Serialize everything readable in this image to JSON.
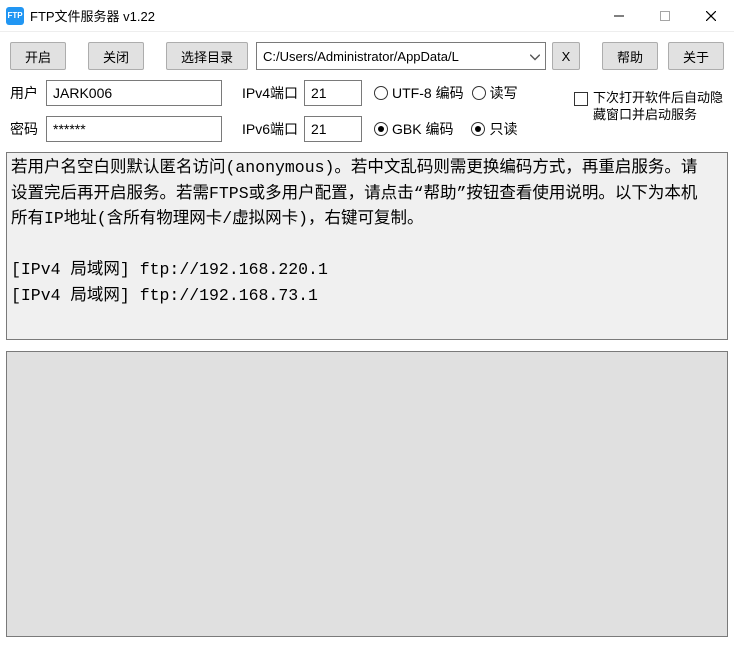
{
  "window": {
    "title": "FTP文件服务器 v1.22",
    "icon_text": "FTP"
  },
  "toolbar": {
    "start": "开启",
    "stop": "关闭",
    "select_dir": "选择目录",
    "path": "C:/Users/Administrator/AppData/L",
    "clear": "X",
    "help": "帮助",
    "about": "关于"
  },
  "config": {
    "user_label": "用户",
    "user_value": "JARK006",
    "pass_label": "密码",
    "pass_value": "******",
    "ipv4_port_label": "IPv4端口",
    "ipv4_port_value": "21",
    "ipv6_port_label": "IPv6端口",
    "ipv6_port_value": "21",
    "encoding_utf8": "UTF-8 编码",
    "encoding_gbk": "GBK 编码",
    "rw_label": "读写",
    "ro_label": "只读",
    "encoding_selected": "gbk",
    "access_selected": "readonly",
    "autostart_label": "下次打开软件后自动隐藏窗口并启动服务",
    "autostart_checked": false
  },
  "info_text": "若用户名空白则默认匿名访问(anonymous)。若中文乱码则需更换编码方式，再重启服务。请设置完后再开启服务。若需FTPS或多用户配置，请点击“帮助”按钮查看使用说明。以下为本机所有IP地址(含所有物理网卡/虚拟网卡)，右键可复制。\n\n[IPv4 局域网] ftp://192.168.220.1\n[IPv4 局域网] ftp://192.168.73.1",
  "log_text": ""
}
